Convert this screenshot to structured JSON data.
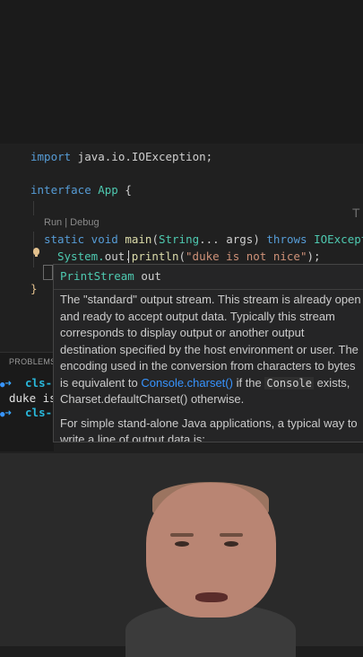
{
  "code": {
    "import_kw": "import",
    "import_path": " java.io.IOException;",
    "interface_kw": "interface",
    "interface_name": " App",
    "interface_brace": " {",
    "codelens": "Run | Debug",
    "main_static": "static",
    "main_void": " void",
    "main_name": " main",
    "main_params_open": "(",
    "main_param_type": "String",
    "main_params_rest": "... args)",
    "main_throws": " throws",
    "main_exception": " IOExcept",
    "println_prefix": "System.",
    "println_out": "out",
    "println_dot": ".",
    "println_method": "println",
    "println_paren": "(",
    "println_string": "\"duke is not nice\"",
    "println_end": ");",
    "closing_brace": "}",
    "ghost_letter": "T"
  },
  "panel": {
    "tab_label": "PROBLEMS"
  },
  "terminal": {
    "line1_cmd": "cls-",
    "line2_output": "duke is",
    "line3_cmd": "cls-"
  },
  "hover": {
    "signature_type": "PrintStream",
    "signature_var": " out",
    "para1": "The \"standard\" output stream. This stream is already open and ready to accept output data. Typically this stream corresponds to display output or another output destination specified by the host environment or user. The encoding used in the conversion from characters to bytes is equivalent to",
    "para1_link": "Console.charset()",
    "para1_if_the": " if the ",
    "para1_console": "Console",
    "para1_exists": " exists, Charset.defaultCharset() otherwise.",
    "para2": "For simple stand-alone Java applications, a typical way to write a line of output data is:"
  }
}
